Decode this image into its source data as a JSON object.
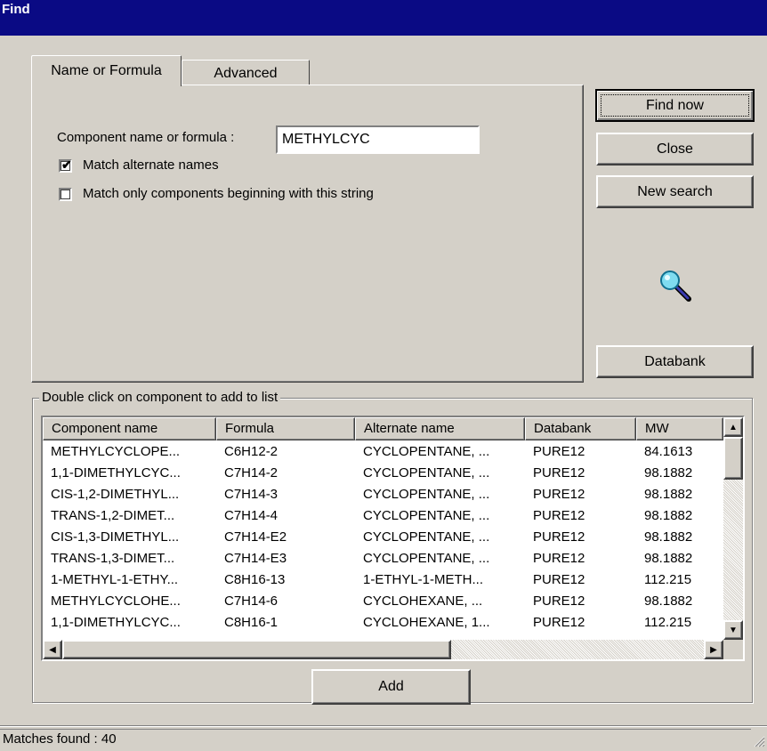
{
  "window": {
    "title": "Find"
  },
  "tabs": [
    {
      "label": "Name or Formula",
      "active": true
    },
    {
      "label": "Advanced",
      "active": false
    }
  ],
  "search": {
    "label": "Component name or formula :",
    "value": "METHYLCYC",
    "match_alternate_label": "Match alternate names",
    "match_alternate_checked": true,
    "match_beginning_label": "Match only components beginning with this string",
    "match_beginning_checked": false
  },
  "buttons": {
    "find_now": "Find now",
    "close": "Close",
    "new_search": "New search",
    "databank": "Databank",
    "add": "Add"
  },
  "icons": {
    "search": "magnifier-icon"
  },
  "results": {
    "group_label": "Double click on component to add to list",
    "columns": [
      "Component name",
      "Formula",
      "Alternate name",
      "Databank",
      "MW"
    ],
    "rows": [
      [
        "METHYLCYCLOPE...",
        "C6H12-2",
        "CYCLOPENTANE, ...",
        "PURE12",
        "84.1613"
      ],
      [
        "1,1-DIMETHYLCYC...",
        "C7H14-2",
        "CYCLOPENTANE, ...",
        "PURE12",
        "98.1882"
      ],
      [
        "CIS-1,2-DIMETHYL...",
        "C7H14-3",
        "CYCLOPENTANE, ...",
        "PURE12",
        "98.1882"
      ],
      [
        "TRANS-1,2-DIMET...",
        "C7H14-4",
        "CYCLOPENTANE, ...",
        "PURE12",
        "98.1882"
      ],
      [
        "CIS-1,3-DIMETHYL...",
        "C7H14-E2",
        "CYCLOPENTANE, ...",
        "PURE12",
        "98.1882"
      ],
      [
        "TRANS-1,3-DIMET...",
        "C7H14-E3",
        "CYCLOPENTANE, ...",
        "PURE12",
        "98.1882"
      ],
      [
        "1-METHYL-1-ETHY...",
        "C8H16-13",
        "1-ETHYL-1-METH...",
        "PURE12",
        "112.215"
      ],
      [
        "METHYLCYCLOHE...",
        "C7H14-6",
        "CYCLOHEXANE, ...",
        "PURE12",
        "98.1882"
      ],
      [
        "1,1-DIMETHYLCYC...",
        "C8H16-1",
        "CYCLOHEXANE, 1...",
        "PURE12",
        "112.215"
      ]
    ]
  },
  "status": {
    "text": "Matches found : 40"
  },
  "colors": {
    "titlebar": "#0a0a84",
    "face": "#d4d0c8"
  }
}
